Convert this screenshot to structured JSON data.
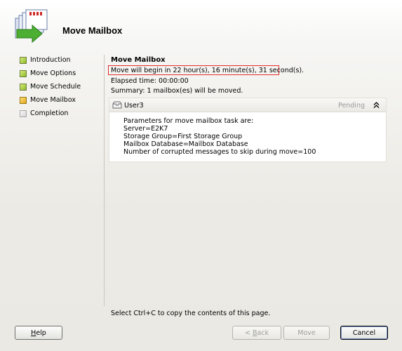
{
  "header": {
    "title": "Move Mailbox"
  },
  "steps": [
    {
      "label": "Introduction",
      "state": "done"
    },
    {
      "label": "Move Options",
      "state": "done"
    },
    {
      "label": "Move Schedule",
      "state": "done"
    },
    {
      "label": "Move Mailbox",
      "state": "current"
    },
    {
      "label": "Completion",
      "state": "pending"
    }
  ],
  "content": {
    "title": "Move Mailbox",
    "begin_status": "Move will begin in 22 hour(s), 16 minute(s), 31 second(s).",
    "elapsed": "Elapsed time: 00:00:00",
    "summary": "Summary: 1 mailbox(es) will be moved."
  },
  "task": {
    "user": "User3",
    "status": "Pending",
    "params_title": "Parameters for move mailbox task are:",
    "server": "Server=E2K7",
    "storage_group": "Storage Group=First Storage Group",
    "mailbox_database": "Mailbox Database=Mailbox Database",
    "corrupted": "Number of corrupted messages to skip during move=100"
  },
  "footer_hint": "Select Ctrl+C to copy the contents of this page.",
  "buttons": {
    "help_mn": "H",
    "help_rest": "elp",
    "back_pre": "< ",
    "back_mn": "B",
    "back_rest": "ack",
    "move": "Move",
    "cancel": "Cancel"
  },
  "colors": {
    "highlight_border": "#e03030"
  }
}
